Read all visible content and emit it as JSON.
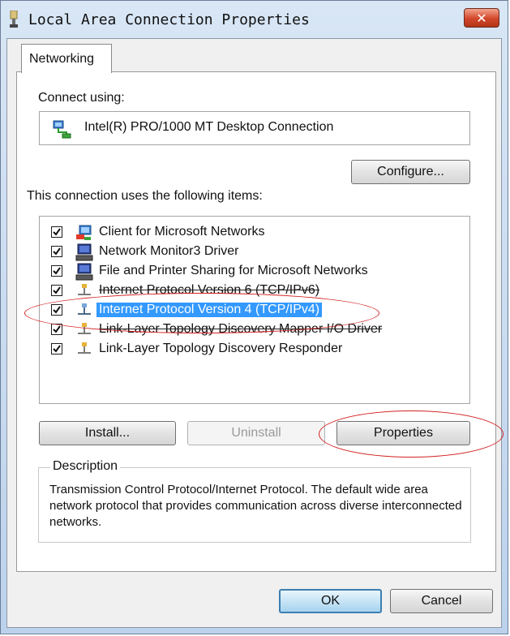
{
  "window": {
    "title": "Local Area Connection Properties",
    "close_label": "✕"
  },
  "tabs": [
    {
      "label": "Networking"
    }
  ],
  "connect_using": {
    "label": "Connect using:",
    "adapter": "Intel(R) PRO/1000 MT Desktop Connection",
    "configure_label": "Configure..."
  },
  "items_section": {
    "label": "This connection uses the following items:",
    "items": [
      {
        "label": "Client for Microsoft Networks",
        "checked": true,
        "icon": "network-client-icon"
      },
      {
        "label": "Network Monitor3 Driver",
        "checked": true,
        "icon": "computer-icon"
      },
      {
        "label": "File and Printer Sharing for Microsoft Networks",
        "checked": true,
        "icon": "computer-icon"
      },
      {
        "label": "Internet Protocol Version 6 (TCP/IPv6)",
        "checked": true,
        "icon": "protocol-icon"
      },
      {
        "label": "Internet Protocol Version 4 (TCP/IPv4)",
        "checked": true,
        "icon": "protocol-icon",
        "selected": true
      },
      {
        "label": "Link-Layer Topology Discovery Mapper I/O Driver",
        "checked": true,
        "icon": "protocol-icon"
      },
      {
        "label": "Link-Layer Topology Discovery Responder",
        "checked": true,
        "icon": "protocol-icon"
      }
    ]
  },
  "buttons": {
    "install": "Install...",
    "uninstall": "Uninstall",
    "properties": "Properties",
    "ok": "OK",
    "cancel": "Cancel"
  },
  "description": {
    "legend": "Description",
    "text": "Transmission Control Protocol/Internet Protocol. The default wide area network protocol that provides communication across diverse interconnected networks."
  },
  "colors": {
    "selection": "#3399ff",
    "annotation": "#d42020",
    "focus_border": "#3c7fb1"
  }
}
